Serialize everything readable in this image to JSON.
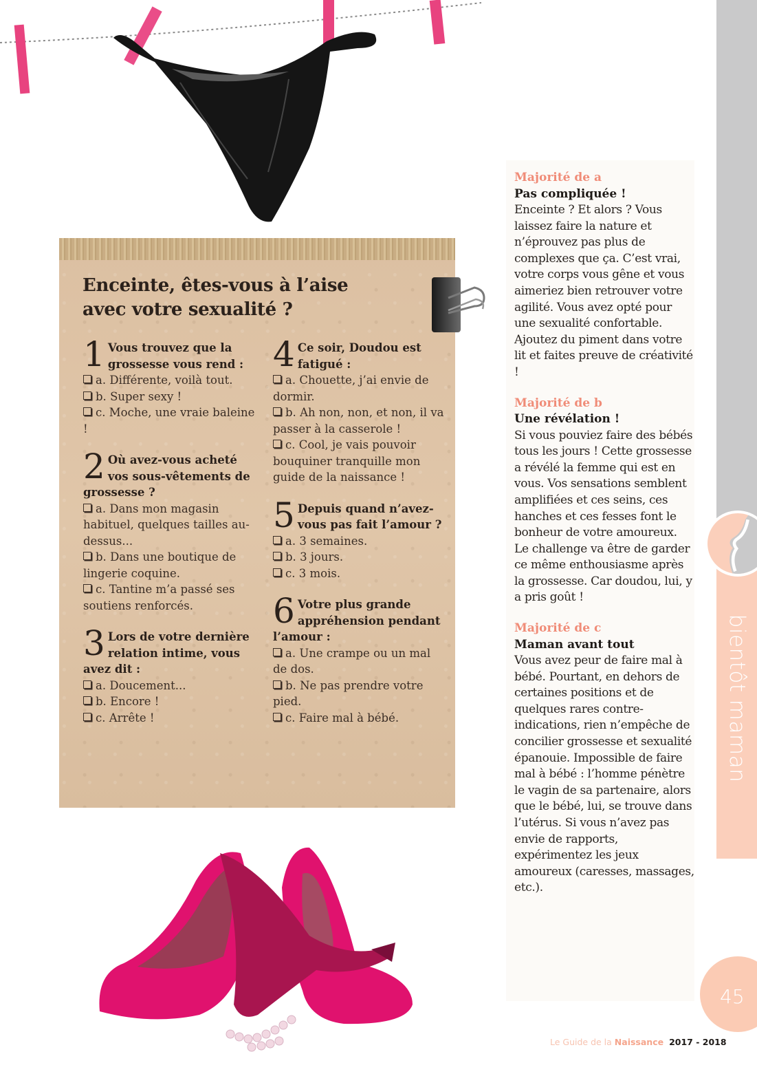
{
  "quiz": {
    "title_line1": "Enceinte, êtes-vous à l’aise",
    "title_line2": "avec votre sexualité ?",
    "questions": [
      {
        "number": "1",
        "text": "Vous trouvez que la grossesse vous rend :",
        "options": [
          {
            "letter": "a.",
            "text": "Différente, voilà tout."
          },
          {
            "letter": "b.",
            "text": "Super sexy !"
          },
          {
            "letter": "c.",
            "text": "Moche, une vraie baleine !"
          }
        ]
      },
      {
        "number": "2",
        "text": "Où avez-vous acheté vos sous-vêtements de grossesse ?",
        "options": [
          {
            "letter": "a.",
            "text": "Dans mon magasin habituel, quelques tailles au-dessus..."
          },
          {
            "letter": "b.",
            "text": "Dans une boutique de lingerie coquine."
          },
          {
            "letter": "c.",
            "text": "Tantine m’a passé ses soutiens renforcés."
          }
        ]
      },
      {
        "number": "3",
        "text": "Lors de votre dernière relation intime, vous avez dit :",
        "options": [
          {
            "letter": "a.",
            "text": "Doucement..."
          },
          {
            "letter": "b.",
            "text": "Encore !"
          },
          {
            "letter": "c.",
            "text": "Arrête !"
          }
        ]
      },
      {
        "number": "4",
        "text": "Ce soir, Doudou est fatigué :",
        "options": [
          {
            "letter": "a.",
            "text": "Chouette, j’ai envie de dormir."
          },
          {
            "letter": "b.",
            "text": "Ah non, non, et non, il va passer à la casserole !"
          },
          {
            "letter": "c.",
            "text": "Cool, je vais pouvoir bouquiner tranquille mon guide de la naissance !"
          }
        ]
      },
      {
        "number": "5",
        "text": "Depuis quand n’avez-vous pas fait l’amour ?",
        "options": [
          {
            "letter": "a.",
            "text": "3 semaines."
          },
          {
            "letter": "b.",
            "text": "3 jours."
          },
          {
            "letter": "c.",
            "text": "3 mois."
          }
        ]
      },
      {
        "number": "6",
        "text": "Votre plus grande appréhension pendant l’amour :",
        "options": [
          {
            "letter": "a.",
            "text": "Une crampe ou un mal de dos."
          },
          {
            "letter": "b.",
            "text": "Ne pas prendre votre pied."
          },
          {
            "letter": "c.",
            "text": "Faire mal à bébé."
          }
        ]
      }
    ]
  },
  "results": [
    {
      "label": "Majorité de a",
      "title": "Pas compliquée !",
      "body": "Enceinte ? Et alors ? Vous laissez faire la nature et n’éprouvez pas plus de complexes que ça. C’est vrai, votre corps vous gêne et vous aimeriez bien retrouver votre agilité. Vous avez opté pour une sexualité confortable. Ajoutez du piment dans votre lit et faites preuve de créativité !"
    },
    {
      "label": "Majorité de b",
      "title": "Une révélation !",
      "body": "Si vous pouviez faire des bébés tous les jours ! Cette grossesse a révélé la femme qui est en vous. Vos sensations semblent amplifiées et ces seins, ces hanches et ces fesses font le bonheur de votre amoureux. Le challenge va être de garder ce même enthousiasme après la grossesse. Car doudou, lui, y a pris goût !"
    },
    {
      "label": "Majorité de c",
      "title": "Maman avant tout",
      "body": "Vous avez peur de faire mal à bébé. Pourtant, en dehors de certaines positions et de quelques rares contre-indications, rien n’empêche de concilier grossesse et sexualité épanouie. Impossible de faire mal à bébé : l’homme pénètre le vagin de sa partenaire, alors que le bébé, lui, se trouve dans l’utérus. Si vous n’avez pas envie de rapports, expérimentez les jeux amoureux (caresses, massages, etc.)."
    }
  ],
  "sidebar": {
    "section_label": "bientôt maman",
    "emblem_icon": "pregnant-silhouette-icon"
  },
  "page": {
    "number": "45"
  },
  "footer": {
    "prefix": "Le Guide de la ",
    "brand": "Naissance",
    "years": "2017 - 2018"
  },
  "illustrations": {
    "top": "black-lace-thong-on-clothesline",
    "bottom": "pink-heels-with-satin-thong-and-pearls",
    "clip": "binder-clip"
  },
  "colors": {
    "accent_salmon": "#f08c78",
    "peach_band": "#fbcfbb",
    "gray_band": "#c9c9ca",
    "kraft_paper": "#ddc2a4",
    "pink_clothespin": "#e8437f",
    "fuchsia_shoes": "#e0126e"
  }
}
